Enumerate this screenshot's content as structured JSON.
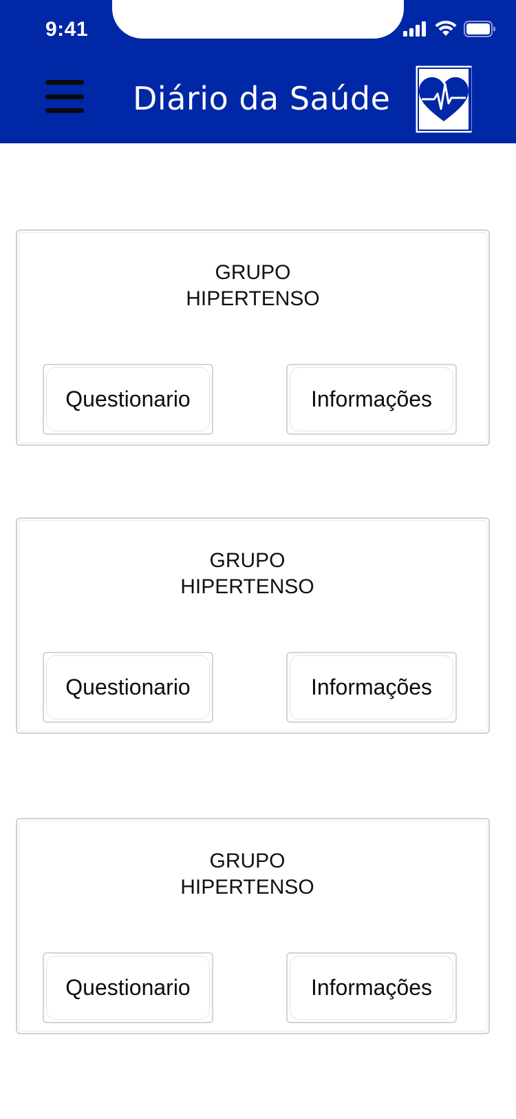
{
  "status_bar": {
    "time": "9:41",
    "icons": [
      "cellular-signal-icon",
      "wifi-icon",
      "battery-icon"
    ]
  },
  "header": {
    "menu_icon": "hamburger-menu-icon",
    "title": "Diário da Saúde",
    "logo_icon": "heart-book-logo-icon",
    "background_color": "#0027a6"
  },
  "cards": [
    {
      "title_line1": "GRUPO",
      "title_line2": "HIPERTENSO",
      "left_button": "Questionario",
      "right_button": "Informações"
    },
    {
      "title_line1": "GRUPO",
      "title_line2": "HIPERTENSO",
      "left_button": "Questionario",
      "right_button": "Informações"
    },
    {
      "title_line1": "GRUPO",
      "title_line2": "HIPERTENSO",
      "left_button": "Questionario",
      "right_button": "Informações"
    }
  ]
}
